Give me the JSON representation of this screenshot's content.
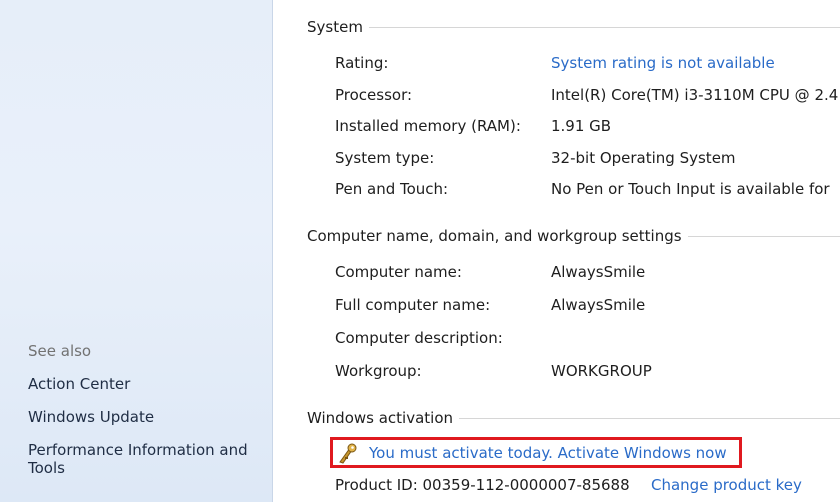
{
  "sidebar": {
    "see_also": "See also",
    "links": [
      "Action Center",
      "Windows Update",
      "Performance Information and",
      "Tools"
    ]
  },
  "system": {
    "heading": "System",
    "rows": [
      {
        "label": "Rating:",
        "value": "System rating is not available",
        "link": true
      },
      {
        "label": "Processor:",
        "value": "Intel(R) Core(TM) i3-3110M CPU @ 2.4"
      },
      {
        "label": "Installed memory (RAM):",
        "value": "1.91 GB"
      },
      {
        "label": "System type:",
        "value": "32-bit Operating System"
      },
      {
        "label": "Pen and Touch:",
        "value": "No Pen or Touch Input is available for"
      }
    ]
  },
  "computer": {
    "heading": "Computer name, domain, and workgroup settings",
    "rows": [
      {
        "label": "Computer name:",
        "value": "AlwaysSmile"
      },
      {
        "label": "Full computer name:",
        "value": "AlwaysSmile"
      },
      {
        "label": "Computer description:",
        "value": ""
      },
      {
        "label": "Workgroup:",
        "value": "WORKGROUP"
      }
    ]
  },
  "activation": {
    "heading": "Windows activation",
    "message": "You must activate today.  Activate Windows now",
    "product_id": "Product ID: 00359-112-0000007-85688",
    "change_key": "Change product key"
  },
  "colors": {
    "link": "#2a6bc8",
    "highlight_border": "#e0191f",
    "sidebar_bg": "#e6eef9"
  },
  "icons": {
    "activation": "key-warning-icon"
  }
}
